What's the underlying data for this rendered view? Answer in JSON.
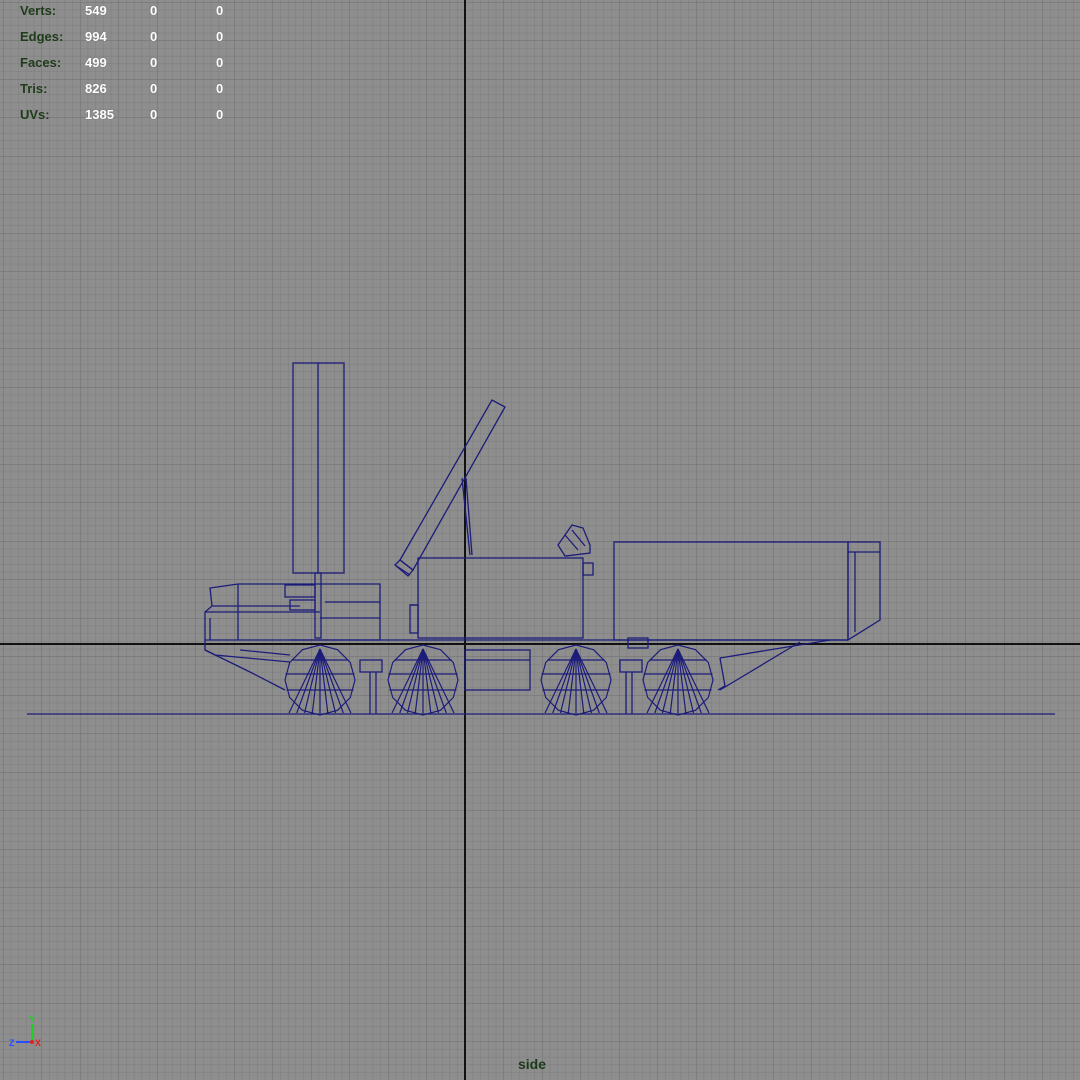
{
  "hud": {
    "rows": [
      {
        "label": "Verts:",
        "v1": "549",
        "v2": "0",
        "v3": "0"
      },
      {
        "label": "Edges:",
        "v1": "994",
        "v2": "0",
        "v3": "0"
      },
      {
        "label": "Faces:",
        "v1": "499",
        "v2": "0",
        "v3": "0"
      },
      {
        "label": "Tris:",
        "v1": "826",
        "v2": "0",
        "v3": "0"
      },
      {
        "label": "UVs:",
        "v1": "1385",
        "v2": "0",
        "v3": "0"
      }
    ]
  },
  "viewport": {
    "camera_label": "side",
    "background_color": "#8e8e8e",
    "grid_color": "#7a7a7a",
    "axis_color": "#111111",
    "wireframe_color": "#1c1c7a"
  },
  "gizmo": {
    "y_label": "Y",
    "z_label": "Z",
    "x_label": "X",
    "y_color": "#1fd11f",
    "z_color": "#2a4cff",
    "x_color": "#e02020"
  }
}
